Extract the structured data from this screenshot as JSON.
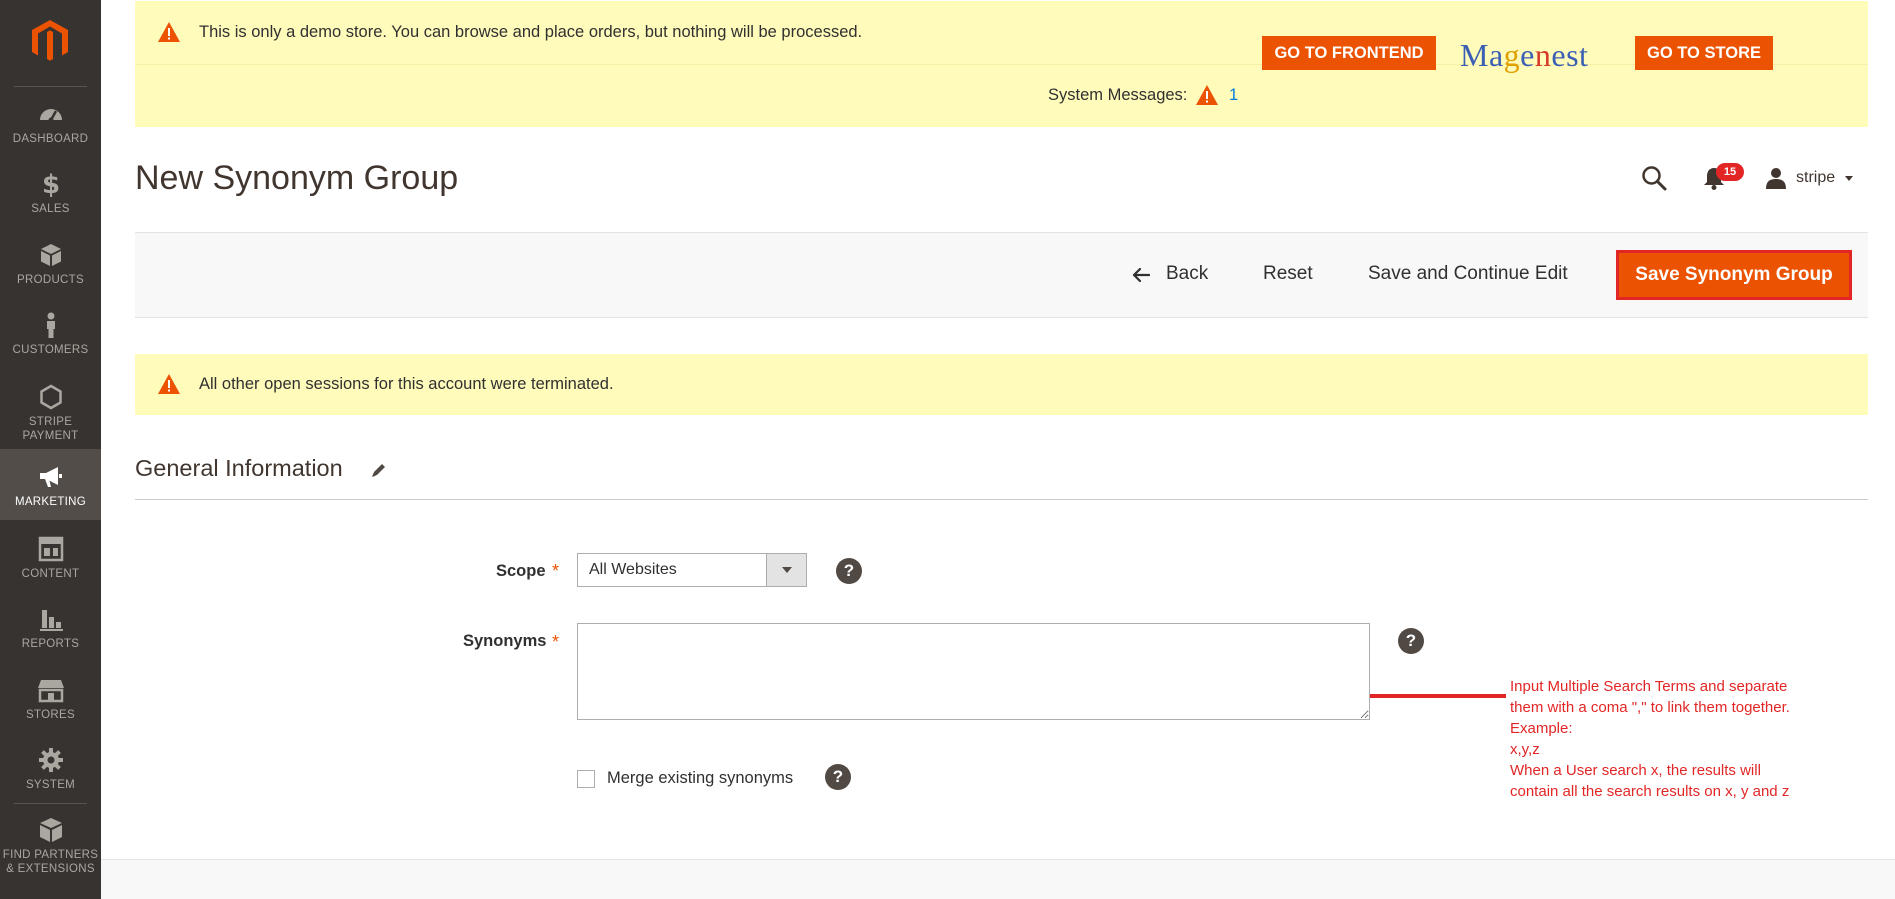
{
  "sidebar": {
    "items": [
      {
        "id": "dashboard",
        "label": "DASHBOARD",
        "icon": "dashboard-icon"
      },
      {
        "id": "sales",
        "label": "SALES",
        "icon": "dollar-icon"
      },
      {
        "id": "products",
        "label": "PRODUCTS",
        "icon": "box-icon"
      },
      {
        "id": "customers",
        "label": "CUSTOMERS",
        "icon": "person-icon"
      },
      {
        "id": "stripe",
        "label_line1": "STRIPE",
        "label_line2": "PAYMENT",
        "icon": "hexagon-icon"
      },
      {
        "id": "marketing",
        "label": "MARKETING",
        "icon": "megaphone-icon",
        "active": true
      },
      {
        "id": "content",
        "label": "CONTENT",
        "icon": "layout-icon"
      },
      {
        "id": "reports",
        "label": "REPORTS",
        "icon": "bar-chart-icon"
      },
      {
        "id": "stores",
        "label": "STORES",
        "icon": "storefront-icon"
      },
      {
        "id": "system",
        "label": "SYSTEM",
        "icon": "gear-icon"
      },
      {
        "id": "partners",
        "label_line1": "FIND PARTNERS",
        "label_line2": "& EXTENSIONS",
        "icon": "cubes-icon"
      }
    ]
  },
  "banner": {
    "demo_text": "This is only a demo store. You can browse and place orders, but nothing will be processed.",
    "go_frontend": "GO TO FRONTEND",
    "go_store": "GO TO STORE",
    "logo_text": "Magenest",
    "system_messages_label": "System Messages:",
    "system_messages_count": "1"
  },
  "header": {
    "title": "New Synonym Group",
    "notifications_count": "15",
    "username": "stripe"
  },
  "actions": {
    "back": "Back",
    "reset": "Reset",
    "save_continue": "Save and Continue Edit",
    "save_primary": "Save Synonym Group"
  },
  "messages": {
    "session": "All other open sessions for this account were terminated."
  },
  "section": {
    "title": "General Information"
  },
  "form": {
    "scope_label": "Scope",
    "scope_value": "All Websites",
    "synonyms_label": "Synonyms",
    "synonyms_value": "",
    "merge_label": "Merge existing synonyms",
    "required_mark": "*",
    "help_glyph": "?"
  },
  "annotation": {
    "lines": [
      "Input Multiple Search Terms and separate",
      "them with a coma \",\" to link them together.",
      "Example:",
      "x,y,z",
      "When a User search x, the results will",
      "contain all the search results on x, y and z"
    ]
  },
  "colors": {
    "accent": "#eb5202",
    "sidebar_bg": "#373330",
    "banner_bg": "#fffbbb",
    "annotation_red": "#e22626"
  }
}
